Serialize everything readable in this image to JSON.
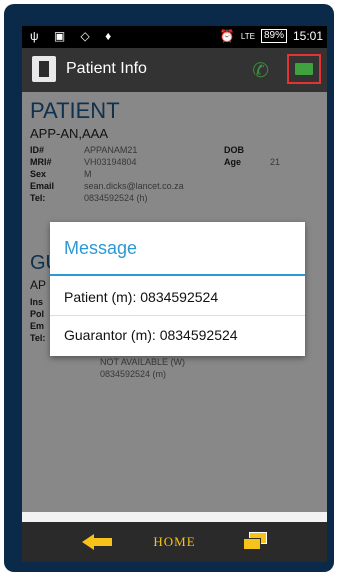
{
  "status_bar": {
    "left_icons": "ψ ▣ ◇ ♦",
    "alarm": "⏰",
    "network": "LTE",
    "battery": "89%",
    "time": "15:01"
  },
  "action_bar": {
    "title": "Patient Info",
    "phone_icon": "phone-icon",
    "message_icon": "message-icon"
  },
  "patient": {
    "section_title": "PATIENT",
    "name": "APP-AN,AAA",
    "fields": [
      {
        "label": "ID#",
        "value": "APPANAM21",
        "label2": "DOB",
        "value2": ""
      },
      {
        "label": "MRI#",
        "value": "VH03194804",
        "label2": "Age",
        "value2": "21"
      },
      {
        "label": "Sex",
        "value": "M",
        "label2": "",
        "value2": ""
      },
      {
        "label": "Email",
        "value": "sean.dicks@lancet.co.za",
        "label2": "",
        "value2": ""
      },
      {
        "label": "Tel:",
        "value": "0834592524 (h)",
        "label2": "",
        "value2": ""
      }
    ]
  },
  "guarantor": {
    "section_title": "GU",
    "name": "AP",
    "labels": [
      "Ins",
      "Pol",
      "Em",
      "Tel:"
    ],
    "values": [
      "NOT AVAILABLE (W)",
      "0834592524 (m)"
    ]
  },
  "dialog": {
    "title": "Message",
    "options": [
      "Patient (m): 0834592524",
      "Guarantor (m): 0834592524"
    ]
  },
  "bottom_bar": {
    "home_label": "HOME"
  }
}
